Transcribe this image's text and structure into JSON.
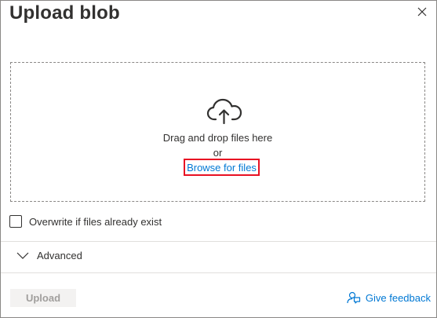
{
  "dialog": {
    "title": "Upload blob",
    "close_icon": "close-icon"
  },
  "dropzone": {
    "icon": "cloud-upload-icon",
    "drag_text": "Drag and drop files here",
    "or_text": "or",
    "browse_label": "Browse for files"
  },
  "options": {
    "overwrite_label": "Overwrite if files already exist",
    "overwrite_checked": false
  },
  "advanced": {
    "label": "Advanced",
    "icon": "chevron-down-icon",
    "expanded": false
  },
  "footer": {
    "upload_label": "Upload",
    "upload_enabled": false,
    "feedback_label": "Give feedback",
    "feedback_icon": "feedback-icon"
  },
  "colors": {
    "link": "#0078d4",
    "highlight": "#e81123",
    "disabled_text": "#a19f9d",
    "disabled_bg": "#f3f2f1"
  }
}
